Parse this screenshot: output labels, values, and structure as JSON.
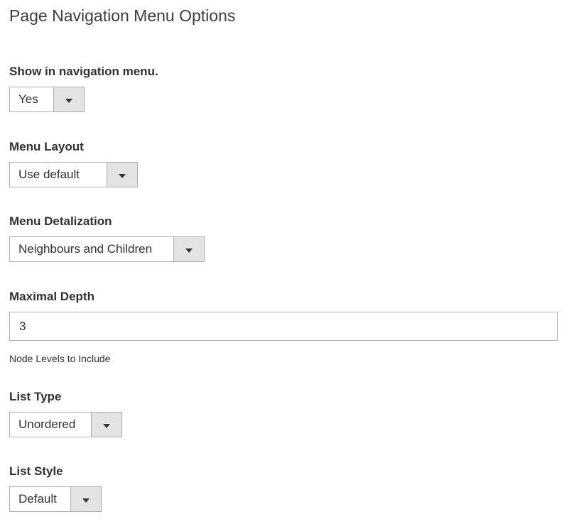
{
  "title": "Page Navigation Menu Options",
  "fields": {
    "show_in_nav": {
      "label": "Show in navigation menu.",
      "value": "Yes"
    },
    "menu_layout": {
      "label": "Menu Layout",
      "value": "Use default"
    },
    "menu_detalization": {
      "label": "Menu Detalization",
      "value": "Neighbours and Children"
    },
    "maximal_depth": {
      "label": "Maximal Depth",
      "value": "3",
      "note": "Node Levels to Include"
    },
    "list_type": {
      "label": "List Type",
      "value": "Unordered"
    },
    "list_style": {
      "label": "List Style",
      "value": "Default"
    }
  }
}
